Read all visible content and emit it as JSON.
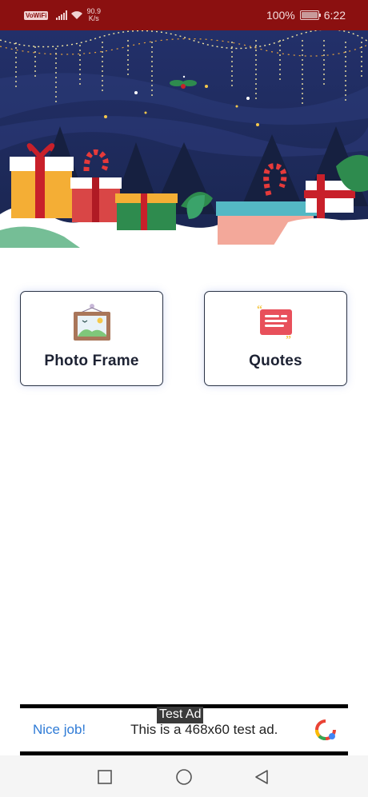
{
  "status_bar": {
    "network_badge": "VoWiFi",
    "speed_value": "90.9",
    "speed_unit": "K/s",
    "battery_percent": "100%",
    "time": "6:22"
  },
  "cards": [
    {
      "label": "Photo Frame",
      "icon": "picture-frame-icon"
    },
    {
      "label": "Quotes",
      "icon": "quote-bubble-icon"
    }
  ],
  "ad": {
    "badge": "Test Ad",
    "headline": "Nice job!",
    "body": "This is a 468x60 test ad.",
    "logo": "google-ads-logo-icon"
  },
  "nav": {
    "buttons": [
      "recent-apps-icon",
      "home-icon",
      "back-icon"
    ]
  },
  "colors": {
    "status_bar": "#8b1010",
    "banner_sky": "#1e2d5c",
    "card_border": "#2a3346",
    "ad_headline": "#2f7bd6"
  }
}
